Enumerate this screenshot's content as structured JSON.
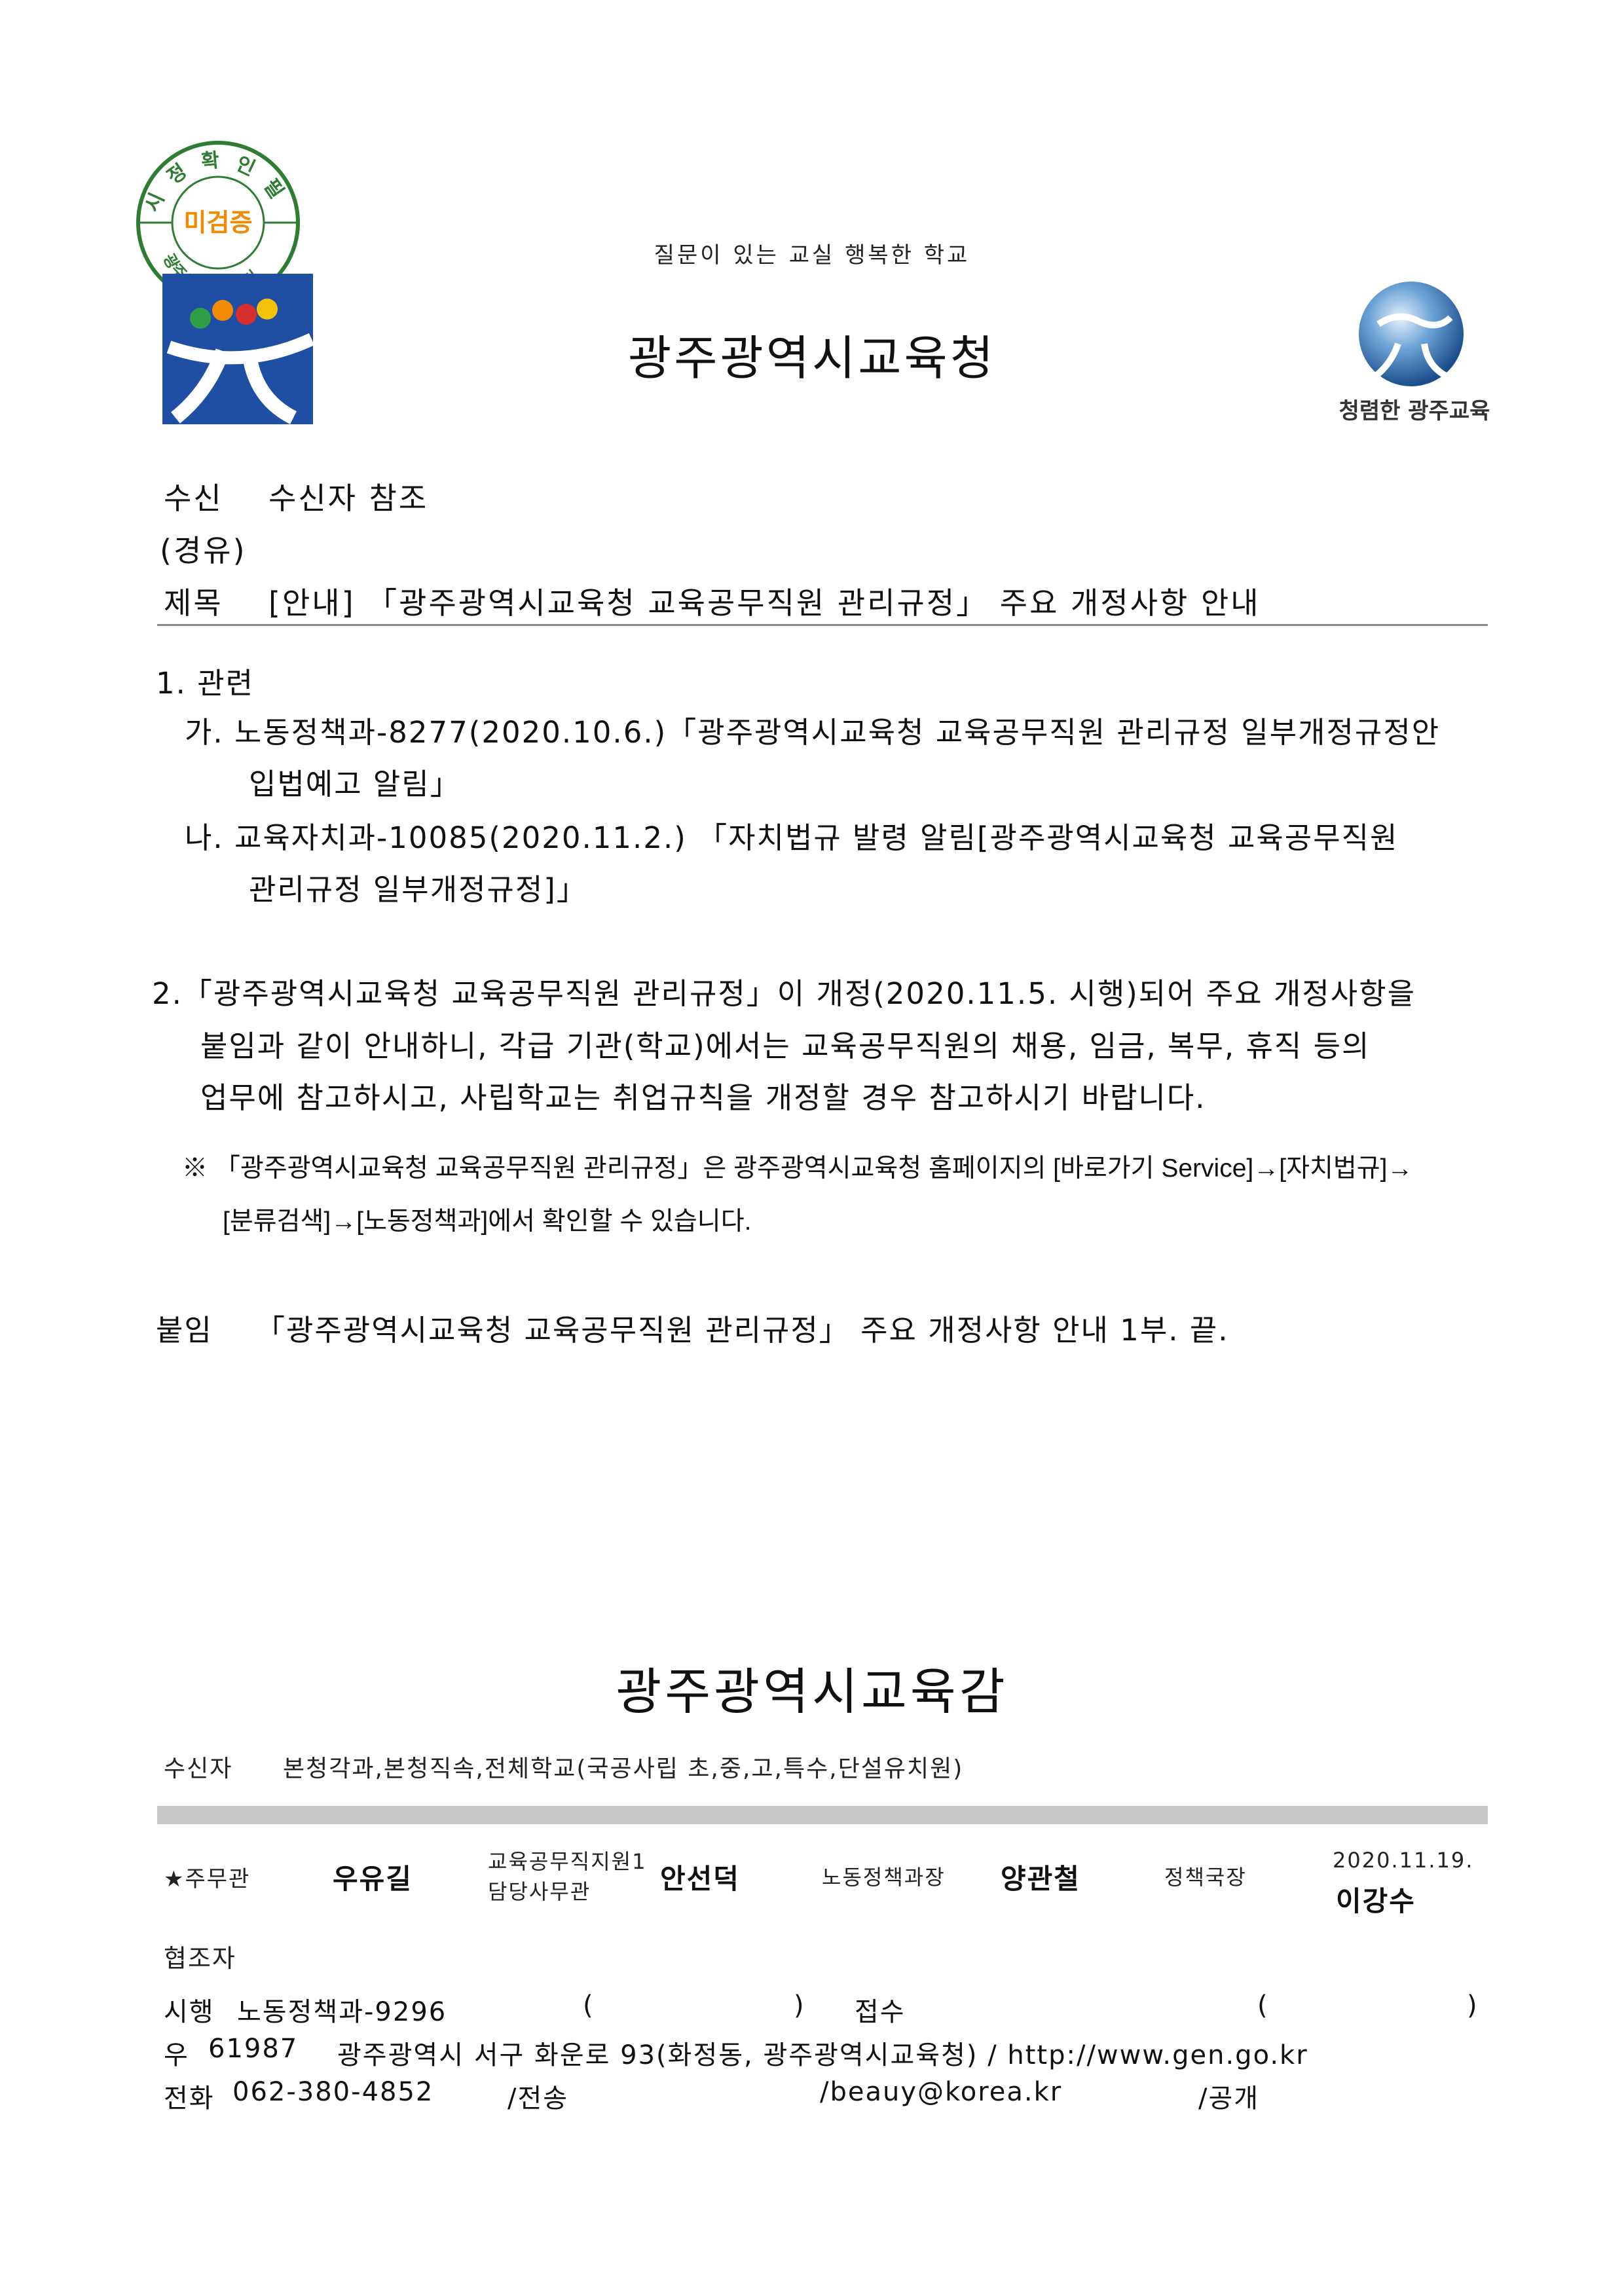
{
  "seal": {
    "top_text": "시 정 확 인 필",
    "center_text": "미검증",
    "bottom_text": "광주시청확인센터"
  },
  "header": {
    "slogan": "질문이 있는 교실  행복한 학교",
    "org_title": "광주광역시교육청",
    "right_logo_caption": "청렴한 광주교육"
  },
  "meta": {
    "recipient_label": "수신",
    "recipient_value": "수신자 참조",
    "via_label": "(경유)",
    "subject_label": "제목",
    "subject_value": "[안내] 「광주광역시교육청 교육공무직원 관리규정」 주요 개정사항 안내"
  },
  "body": {
    "item1_title": "1. 관련",
    "item1_ga_line1": "가. 노동정책과-8277(2020.10.6.)「광주광역시교육청 교육공무직원 관리규정 일부개정규정안",
    "item1_ga_line2": "입법예고 알림」",
    "item1_na_line1": "나. 교육자치과-10085(2020.11.2.) 「자치법규 발령 알림[광주광역시교육청 교육공무직원",
    "item1_na_line2": "관리규정 일부개정규정]」",
    "item2_line1": "2.「광주광역시교육청 교육공무직원 관리규정」이 개정(2020.11.5. 시행)되어 주요 개정사항을",
    "item2_line2": "붙임과 같이 안내하니, 각급 기관(학교)에서는 교육공무직원의 채용, 임금, 복무, 휴직 등의",
    "item2_line3": "업무에 참고하시고, 사립학교는 취업규칙을 개정할 경우 참고하시기 바랍니다.",
    "note_line1": "※ 「광주광역시교육청 교육공무직원 관리규정」은 광주광역시교육청 홈페이지의 [바로가기 Service]→[자치법규]→",
    "note_line2": "[분류검색]→[노동정책과]에서 확인할 수 있습니다.",
    "attachment_label": "붙임",
    "attachment_value": "「광주광역시교육청 교육공무직원 관리규정」 주요 개정사항 안내 1부.  끝."
  },
  "footer": {
    "sender": "광주광역시교육감",
    "recipients_label": "수신자",
    "recipients_value": "본청각과,본청직속,전체학교(국공사립 초,중,고,특수,단설유치원)",
    "approval": {
      "role1": "★주무관",
      "name1": "우유길",
      "role2_line1": "교육공무직지원1",
      "role2_line2": "담당사무관",
      "name2": "안선덕",
      "role3": "노동정책과장",
      "name3": "양관철",
      "role4": "정책국장",
      "date": "2020.11.19.",
      "name4": "이강수"
    },
    "cooperator_label": "협조자",
    "enforce_label": "시행",
    "enforce_value": "노동정책과-9296",
    "enforce_paren_open": "(",
    "enforce_paren_close": ")",
    "receipt_label": "접수",
    "receipt_paren_open": "(",
    "receipt_paren_close": ")",
    "postal_label": "우",
    "postal_code": "61987",
    "address": "광주광역시 서구 화운로 93(화정동, 광주광역시교육청) / http://www.gen.go.kr",
    "phone_label": "전화",
    "phone_value": "062-380-4852",
    "fax_label": "/전송",
    "email": "/beauy@korea.kr",
    "disclosure": "/공개"
  }
}
